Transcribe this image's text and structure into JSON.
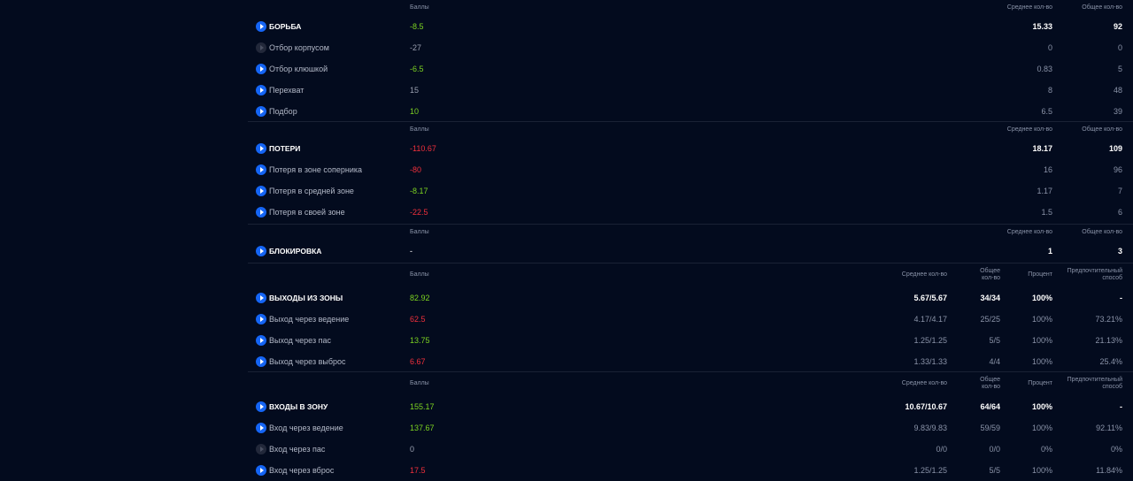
{
  "sections": [
    {
      "headers": {
        "score": "Баллы",
        "avg": "Среднее кол-во",
        "total": "Общее кол-во"
      },
      "rows": [
        {
          "label": "БОРЬБА",
          "score": "-8.5",
          "score_color": "green",
          "avg": "15.33",
          "total": "92",
          "main": true
        },
        {
          "label": "Отбор корпусом",
          "score": "-27",
          "score_color": "neutral",
          "avg": "0",
          "total": "0",
          "dim": true
        },
        {
          "label": "Отбор клюшкой",
          "score": "-6.5",
          "score_color": "green",
          "avg": "0.83",
          "total": "5"
        },
        {
          "label": "Перехват",
          "score": "15",
          "score_color": "neutral",
          "avg": "8",
          "total": "48"
        },
        {
          "label": "Подбор",
          "score": "10",
          "score_color": "green",
          "avg": "6.5",
          "total": "39"
        }
      ]
    },
    {
      "headers": {
        "score": "Баллы",
        "avg": "Среднее кол-во",
        "total": "Общее кол-во"
      },
      "rows": [
        {
          "label": "ПОТЕРИ",
          "score": "-110.67",
          "score_color": "red",
          "avg": "18.17",
          "total": "109",
          "main": true
        },
        {
          "label": "Потеря в зоне соперника",
          "score": "-80",
          "score_color": "red",
          "avg": "16",
          "total": "96"
        },
        {
          "label": "Потеря в средней зоне",
          "score": "-8.17",
          "score_color": "green",
          "avg": "1.17",
          "total": "7"
        },
        {
          "label": "Потеря в своей зоне",
          "score": "-22.5",
          "score_color": "red",
          "avg": "1.5",
          "total": "6"
        }
      ]
    },
    {
      "headers": {
        "score": "Баллы",
        "avg": "Среднее кол-во",
        "total": "Общее кол-во"
      },
      "rows": [
        {
          "label": "БЛОКИРОВКА",
          "score": "-",
          "score_color": "white",
          "avg": "1",
          "total": "3",
          "main": true
        }
      ]
    },
    {
      "headers": {
        "score": "Баллы",
        "avg": "Среднее кол-во",
        "total": "Общее\nкол-во",
        "percent": "Процент",
        "preferred": "Предпочтительный\nспособ"
      },
      "rows": [
        {
          "label": "ВЫХОДЫ ИЗ ЗОНЫ",
          "score": "82.92",
          "score_color": "green",
          "avg": "5.67/5.67",
          "total": "34/34",
          "percent": "100%",
          "preferred": "-",
          "main": true
        },
        {
          "label": "Выход через ведение",
          "score": "62.5",
          "score_color": "red",
          "avg": "4.17/4.17",
          "total": "25/25",
          "percent": "100%",
          "preferred": "73.21%"
        },
        {
          "label": "Выход через пас",
          "score": "13.75",
          "score_color": "green",
          "avg": "1.25/1.25",
          "total": "5/5",
          "percent": "100%",
          "preferred": "21.13%"
        },
        {
          "label": "Выход через выброс",
          "score": "6.67",
          "score_color": "red",
          "avg": "1.33/1.33",
          "total": "4/4",
          "percent": "100%",
          "preferred": "25.4%"
        }
      ]
    },
    {
      "headers": {
        "score": "Баллы",
        "avg": "Среднее кол-во",
        "total": "Общее\nкол-во",
        "percent": "Процент",
        "preferred": "Предпочтительный\nспособ"
      },
      "rows": [
        {
          "label": "ВХОДЫ В ЗОНУ",
          "score": "155.17",
          "score_color": "green",
          "avg": "10.67/10.67",
          "total": "64/64",
          "percent": "100%",
          "preferred": "-",
          "main": true
        },
        {
          "label": "Вход через ведение",
          "score": "137.67",
          "score_color": "green",
          "avg": "9.83/9.83",
          "total": "59/59",
          "percent": "100%",
          "preferred": "92.11%"
        },
        {
          "label": "Вход через пас",
          "score": "0",
          "score_color": "neutral",
          "avg": "0/0",
          "total": "0/0",
          "percent": "0%",
          "preferred": "0%",
          "dim": true
        },
        {
          "label": "Вход через вброс",
          "score": "17.5",
          "score_color": "red",
          "avg": "1.25/1.25",
          "total": "5/5",
          "percent": "100%",
          "preferred": "11.84%"
        }
      ]
    }
  ],
  "colors": {
    "green": "#7cd321",
    "red": "#f0303c",
    "accent": "#1565f5",
    "background": "#030b1e"
  },
  "icons": {
    "row_action": "play-icon"
  }
}
